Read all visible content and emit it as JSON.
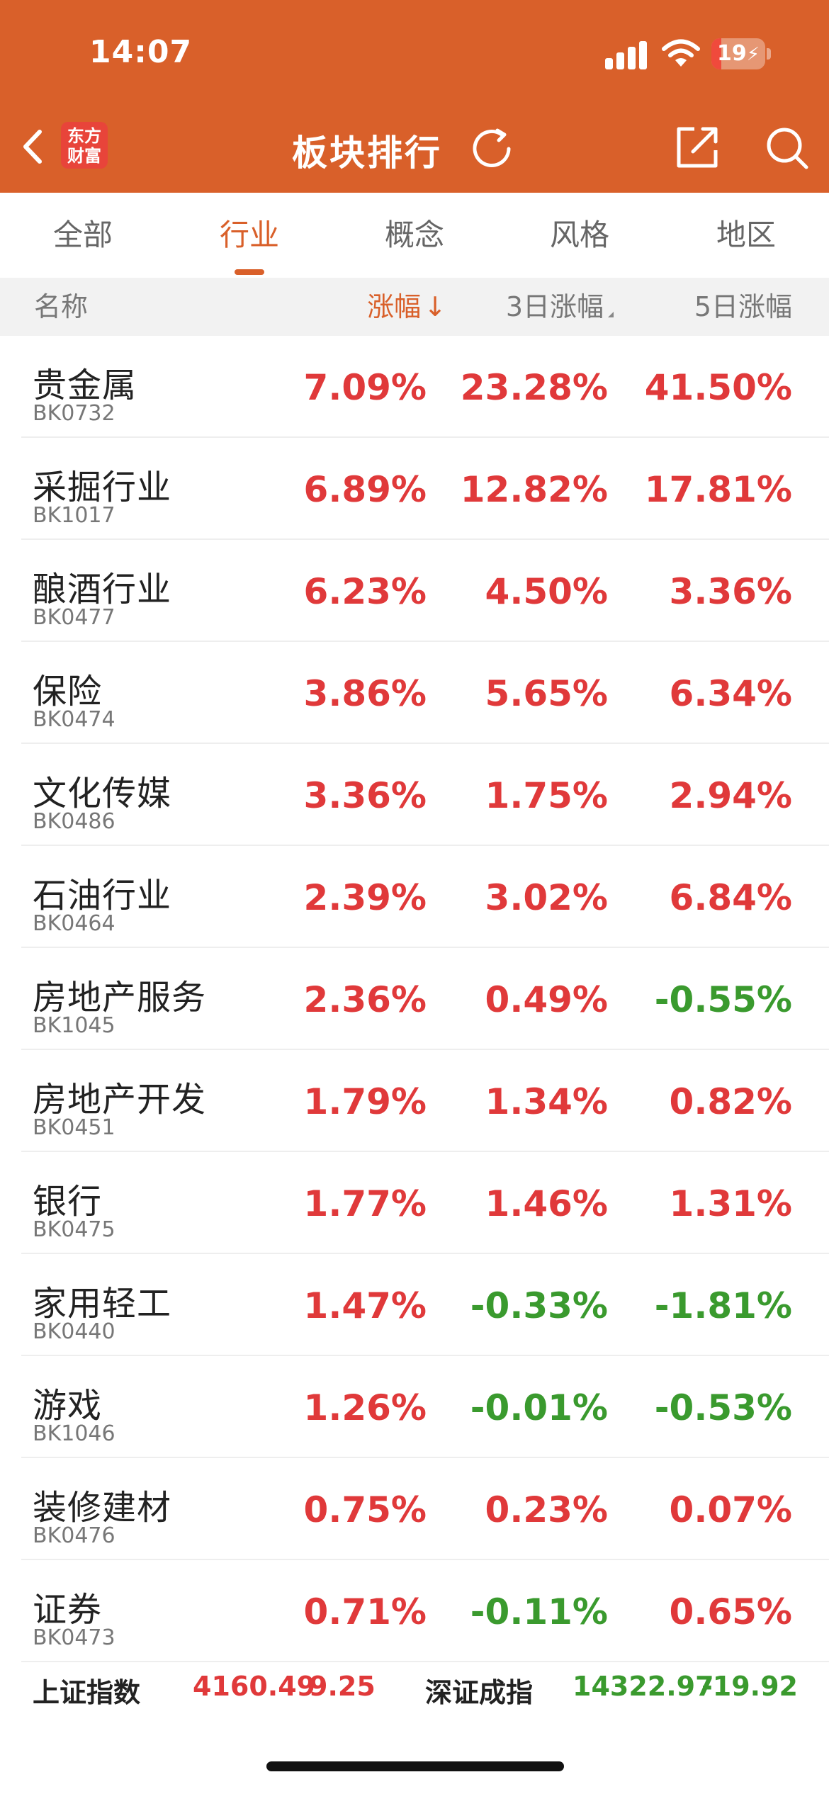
{
  "status_bar": {
    "time": "14:07",
    "battery": "19",
    "battery_fraction": 0.19
  },
  "header": {
    "logo_line1": "东方",
    "logo_line2": "财富",
    "title": "板块排行"
  },
  "tabs": [
    {
      "label": "全部"
    },
    {
      "label": "行业"
    },
    {
      "label": "概念"
    },
    {
      "label": "风格"
    },
    {
      "label": "地区"
    }
  ],
  "active_tab": "行业",
  "columns": {
    "name": "名称",
    "change": "涨幅",
    "change_sort_arrow": "↓",
    "change_3d": "3日涨幅",
    "change_5d": "5日涨幅"
  },
  "colors": {
    "brand": "#D9602A",
    "up": "#E0393A",
    "down": "#3A9A2E"
  },
  "rows": [
    {
      "name": "贵金属",
      "code": "BK0732",
      "chg": "7.09%",
      "chg3": "23.28%",
      "chg5": "41.50%"
    },
    {
      "name": "采掘行业",
      "code": "BK1017",
      "chg": "6.89%",
      "chg3": "12.82%",
      "chg5": "17.81%"
    },
    {
      "name": "酿酒行业",
      "code": "BK0477",
      "chg": "6.23%",
      "chg3": "4.50%",
      "chg5": "3.36%"
    },
    {
      "name": "保险",
      "code": "BK0474",
      "chg": "3.86%",
      "chg3": "5.65%",
      "chg5": "6.34%"
    },
    {
      "name": "文化传媒",
      "code": "BK0486",
      "chg": "3.36%",
      "chg3": "1.75%",
      "chg5": "2.94%"
    },
    {
      "name": "石油行业",
      "code": "BK0464",
      "chg": "2.39%",
      "chg3": "3.02%",
      "chg5": "6.84%"
    },
    {
      "name": "房地产服务",
      "code": "BK1045",
      "chg": "2.36%",
      "chg3": "0.49%",
      "chg5": "-0.55%"
    },
    {
      "name": "房地产开发",
      "code": "BK0451",
      "chg": "1.79%",
      "chg3": "1.34%",
      "chg5": "0.82%"
    },
    {
      "name": "银行",
      "code": "BK0475",
      "chg": "1.77%",
      "chg3": "1.46%",
      "chg5": "1.31%"
    },
    {
      "name": "家用轻工",
      "code": "BK0440",
      "chg": "1.47%",
      "chg3": "-0.33%",
      "chg5": "-1.81%"
    },
    {
      "name": "游戏",
      "code": "BK1046",
      "chg": "1.26%",
      "chg3": "-0.01%",
      "chg5": "-0.53%"
    },
    {
      "name": "装修建材",
      "code": "BK0476",
      "chg": "0.75%",
      "chg3": "0.23%",
      "chg5": "0.07%"
    },
    {
      "name": "证券",
      "code": "BK0473",
      "chg": "0.71%",
      "chg3": "-0.11%",
      "chg5": "0.65%"
    }
  ],
  "index_bar": {
    "sh": {
      "name": "上证指数",
      "value": "4160.49",
      "change": "9.25"
    },
    "sz": {
      "name": "深证成指",
      "value": "14322.97",
      "change": "-19.92"
    }
  }
}
